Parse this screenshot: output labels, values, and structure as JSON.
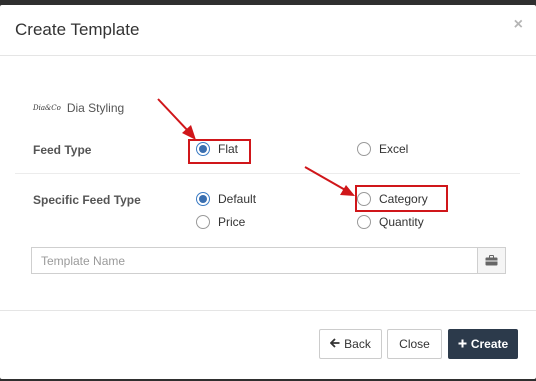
{
  "modal": {
    "title": "Create Template",
    "close_glyph": "×"
  },
  "brand": {
    "logo_text": "Dia&Co",
    "name": "Dia Styling"
  },
  "feed_type": {
    "label": "Feed Type",
    "options": [
      {
        "label": "Flat",
        "checked": true
      },
      {
        "label": "Excel",
        "checked": false
      }
    ]
  },
  "specific_feed_type": {
    "label": "Specific Feed Type",
    "options": [
      {
        "label": "Default",
        "checked": true
      },
      {
        "label": "Category",
        "checked": false
      },
      {
        "label": "Price",
        "checked": false
      },
      {
        "label": "Quantity",
        "checked": false
      }
    ]
  },
  "template_name": {
    "placeholder": "Template Name",
    "value": "",
    "addon_icon": "briefcase-icon"
  },
  "footer": {
    "back_label": "Back",
    "close_label": "Close",
    "create_label": "Create"
  },
  "colors": {
    "highlight": "#d0161a",
    "primary_button": "#2c3a4b",
    "radio_checked": "#3a6fb0"
  }
}
